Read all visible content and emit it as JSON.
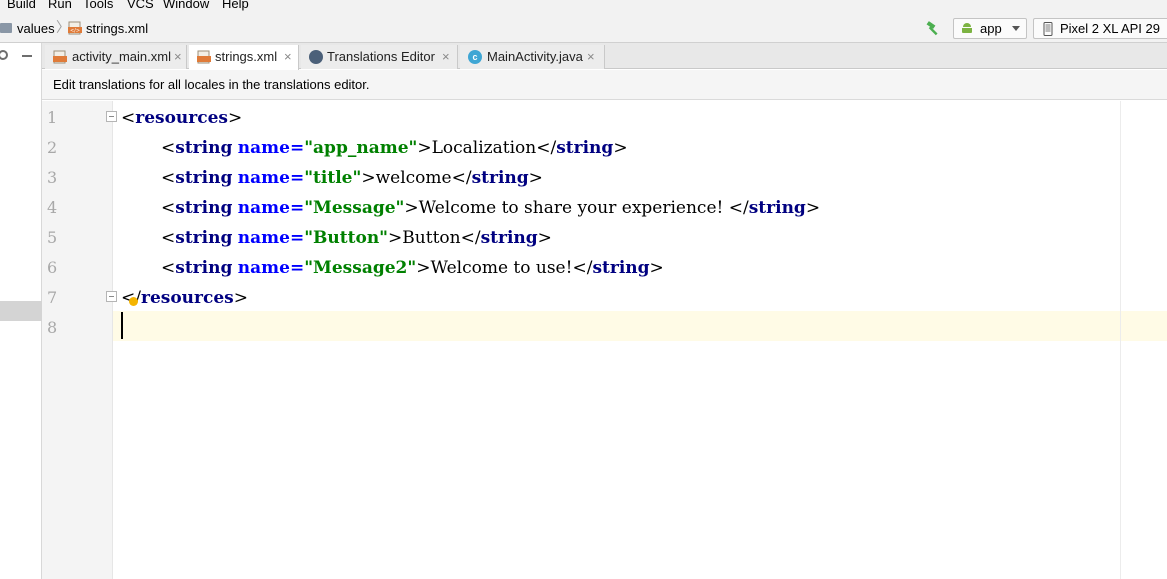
{
  "menu": {
    "items": [
      "Build",
      "Run",
      "Tools",
      "VCS",
      "Window",
      "Help"
    ]
  },
  "nav": {
    "crumb_folder": "values",
    "crumb_file": "strings.xml",
    "run_config": "app",
    "device": "Pixel 2 XL API 29"
  },
  "tabs": [
    {
      "label": "activity_main.xml",
      "close": "×"
    },
    {
      "label": "strings.xml",
      "close": "×"
    },
    {
      "label": "Translations Editor",
      "close": "×"
    },
    {
      "label": "MainActivity.java",
      "close": "×"
    }
  ],
  "notice": {
    "text": "Edit translations for all locales in the translations editor."
  },
  "editor": {
    "line_numbers": [
      "1",
      "2",
      "3",
      "4",
      "5",
      "6",
      "7",
      "8"
    ],
    "tokens": {
      "lt": "<",
      "gt": ">",
      "lt_slash": "</",
      "slash": "/",
      "eq": "=",
      "resources": "resources",
      "string": "string",
      "name": "name"
    },
    "strings": [
      {
        "key": "\"app_name\"",
        "value": "Localization"
      },
      {
        "key": "\"title\"",
        "value": "welcome"
      },
      {
        "key": "\"Message\"",
        "value": "Welcome to share your experience! "
      },
      {
        "key": "\"Button\"",
        "value": "Button"
      },
      {
        "key": "\"Message2\"",
        "value": "Welcome to use!"
      }
    ]
  },
  "colors": {
    "tag": "#000080",
    "attribute": "#0000ff",
    "value": "#008000",
    "current_line": "#fffbe6",
    "bulb": "#f4b400"
  },
  "icons": {
    "folder": "folder-icon",
    "xml_file": "xml-file-icon",
    "build": "hammer-icon",
    "android": "android-icon",
    "device": "phone-icon",
    "settings": "gear-icon",
    "minimize": "minimize-icon",
    "translations": "globe-icon",
    "java_class": "class-icon",
    "intention": "bulb-icon"
  }
}
